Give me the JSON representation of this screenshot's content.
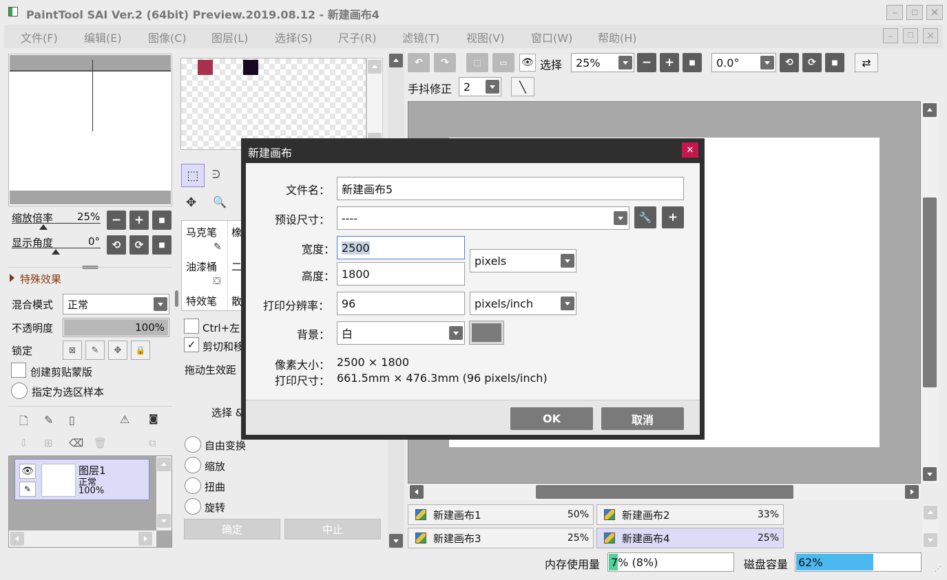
{
  "window": {
    "title": "PaintTool SAI Ver.2 (64bit) Preview.2019.08.12 - 新建画布4"
  },
  "menu": [
    "文件(F)",
    "编辑(E)",
    "图像(C)",
    "图层(L)",
    "选择(S)",
    "尺子(R)",
    "滤镜(T)",
    "视图(V)",
    "窗口(W)",
    "帮助(H)"
  ],
  "navigator": {
    "zoom_label": "缩放倍率",
    "zoom_value": "25%",
    "angle_label": "显示角度",
    "angle_value": "0°"
  },
  "layer_props": {
    "effects_label": "特殊效果",
    "blend_label": "混合模式",
    "blend_value": "正常",
    "opacity_label": "不透明度",
    "opacity_value": "100%",
    "opacity_fraction": 1.0,
    "lock_label": "锁定",
    "clip_label": "创建剪贴蒙版",
    "sample_label": "指定为选区样本"
  },
  "layers": [
    {
      "name": "图层1",
      "mode": "正常",
      "opacity": "100%"
    }
  ],
  "tools": {
    "brushes": [
      "马克笔",
      "橡",
      "油漆桶",
      "二",
      "特效笔",
      "散"
    ],
    "option_ctrl": "Ctrl+左",
    "option_clip": "剪切和移",
    "drag_label": "拖动生效距",
    "select_label": "选择 &"
  },
  "transform": {
    "options": [
      "自由变换",
      "缩放",
      "扭曲",
      "旋转"
    ],
    "confirm": "确定",
    "abort": "中止"
  },
  "toolbar": {
    "select_label": "选择",
    "zoom_value": "25%",
    "angle_value": "0.0°",
    "stabilizer_label": "手抖修正",
    "stabilizer_value": "2"
  },
  "canvas_tabs": [
    {
      "name": "新建画布1",
      "zoom": "50%",
      "active": false
    },
    {
      "name": "新建画布2",
      "zoom": "33%",
      "active": false
    },
    {
      "name": "新建画布3",
      "zoom": "25%",
      "active": false
    },
    {
      "name": "新建画布4",
      "zoom": "25%",
      "active": true
    }
  ],
  "status": {
    "memory_label": "内存使用量",
    "memory_value": "7% (8%)",
    "memory_fraction": 0.07,
    "disk_label": "磁盘容量",
    "disk_value": "62%",
    "disk_fraction": 0.62
  },
  "dialog": {
    "title": "新建画布",
    "filename_label": "文件名：",
    "filename_value": "新建画布5",
    "preset_label": "预设尺寸：",
    "preset_value": "----",
    "width_label": "宽度：",
    "width_value": "2500",
    "height_label": "高度：",
    "height_value": "1800",
    "size_unit": "pixels",
    "dpi_label": "打印分辨率：",
    "dpi_value": "96",
    "dpi_unit": "pixels/inch",
    "bg_label": "背景：",
    "bg_value": "白",
    "pixel_size_label": "像素大小：",
    "pixel_size_value": "2500 × 1800",
    "print_size_label": "打印尺寸：",
    "print_size_value": "661.5mm × 476.3mm (96 pixels/inch)",
    "ok": "OK",
    "cancel": "取消"
  },
  "colors": {
    "swatch1": "#a8304f",
    "swatch2": "#1a0822",
    "dialog_close": "#c4184c",
    "bg_color_swatch": "#7a7a7a",
    "memory_bar": "#4fd197",
    "disk_bar": "#4ab9f0",
    "active_tab": "#dcdcf8"
  }
}
